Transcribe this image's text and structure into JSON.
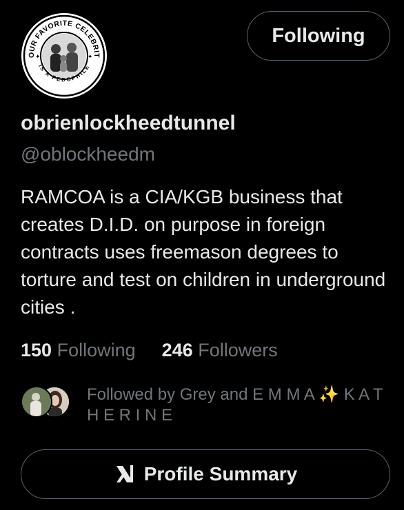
{
  "header": {
    "avatar_text_top": "YOUR FAVORITE CELEBRITY",
    "avatar_text_bottom": "IS A PEDOPHILE",
    "follow_label": "Following"
  },
  "profile": {
    "display_name": "obrienlockheedtunnel",
    "handle": "@oblockheedm",
    "bio": "RAMCOA is a CIA/KGB business that creates D.I.D. on purpose in foreign contracts uses freemason degrees to torture and test on children in underground cities ."
  },
  "stats": {
    "following_count": "150",
    "following_label": "Following",
    "followers_count": "246",
    "followers_label": "Followers"
  },
  "followed_by": {
    "text": "Followed by Grey and E M M A ✨ K A T H E R I N E"
  },
  "actions": {
    "summary_label": "Profile Summary"
  },
  "colors": {
    "background": "#000000",
    "primary_text": "#e7e9ea",
    "secondary_text": "#71767b",
    "border": "#536471"
  }
}
